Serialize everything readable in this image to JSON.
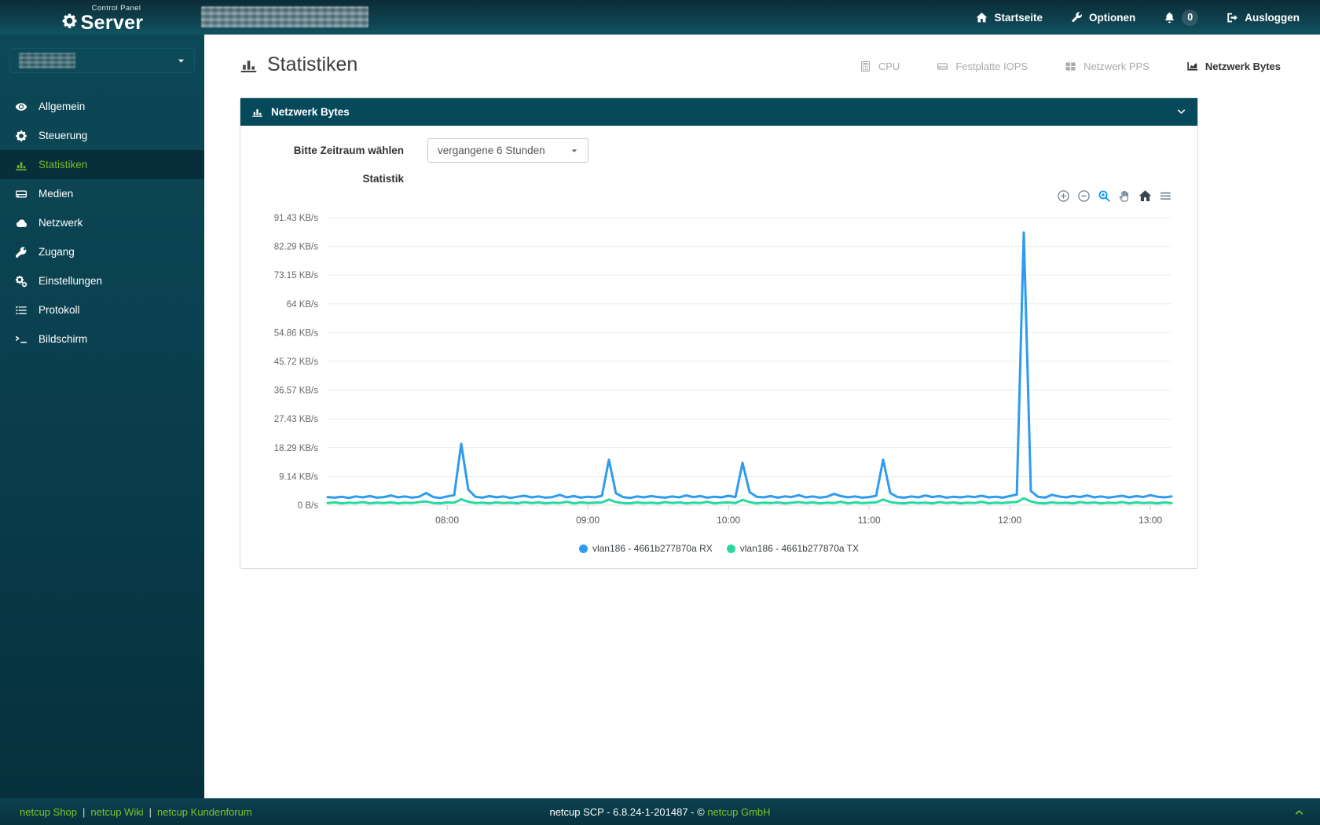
{
  "topbar": {
    "logo_small": "Control Panel",
    "logo_brand": "Server",
    "startseite": "Startseite",
    "optionen": "Optionen",
    "notification_count": "0",
    "ausloggen": "Ausloggen"
  },
  "sidebar": {
    "items": [
      {
        "label": "Allgemein",
        "icon": "eye-icon"
      },
      {
        "label": "Steuerung",
        "icon": "gear-icon"
      },
      {
        "label": "Statistiken",
        "icon": "bar-chart-icon"
      },
      {
        "label": "Medien",
        "icon": "hdd-icon"
      },
      {
        "label": "Netzwerk",
        "icon": "cloud-icon"
      },
      {
        "label": "Zugang",
        "icon": "key-icon"
      },
      {
        "label": "Einstellungen",
        "icon": "gears-icon"
      },
      {
        "label": "Protokoll",
        "icon": "list-icon"
      },
      {
        "label": "Bildschirm",
        "icon": "terminal-icon"
      }
    ]
  },
  "main": {
    "title": "Statistiken",
    "tabs": [
      {
        "label": "CPU",
        "icon": "calculator-icon"
      },
      {
        "label": "Festplatte IOPS",
        "icon": "hdd-icon"
      },
      {
        "label": "Netzwerk PPS",
        "icon": "grid-icon"
      },
      {
        "label": "Netzwerk Bytes",
        "icon": "area-chart-icon"
      }
    ]
  },
  "panel": {
    "title": "Netzwerk Bytes",
    "timerange_label": "Bitte Zeitraum wählen",
    "timerange_value": "vergangene 6 Stunden",
    "statistik_label": "Statistik"
  },
  "chart_data": {
    "type": "line",
    "y_max": 91.43,
    "grid_color": "#ececec",
    "y_ticks": [
      {
        "label": "91.43 KB/s",
        "value": 91.43
      },
      {
        "label": "82.29 KB/s",
        "value": 82.29
      },
      {
        "label": "73.15 KB/s",
        "value": 73.15
      },
      {
        "label": "64 KB/s",
        "value": 64
      },
      {
        "label": "54.86 KB/s",
        "value": 54.86
      },
      {
        "label": "45.72 KB/s",
        "value": 45.72
      },
      {
        "label": "36.57 KB/s",
        "value": 36.57
      },
      {
        "label": "27.43 KB/s",
        "value": 27.43
      },
      {
        "label": "18.29 KB/s",
        "value": 18.29
      },
      {
        "label": "9.14 KB/s",
        "value": 9.14
      },
      {
        "label": "0 B/s",
        "value": 0
      }
    ],
    "x_total_min": 360,
    "x_step_min": 3,
    "x_start_time": "07:09",
    "x_ticks": [
      {
        "label": "08:00",
        "min": 51
      },
      {
        "label": "09:00",
        "min": 111
      },
      {
        "label": "10:00",
        "min": 171
      },
      {
        "label": "11:00",
        "min": 231
      },
      {
        "label": "12:00",
        "min": 291
      },
      {
        "label": "13:00",
        "min": 351
      }
    ],
    "toolbar_icons": [
      "zoom-in",
      "zoom-out",
      "selection-zoom",
      "pan",
      "reset-home",
      "menu"
    ],
    "series": [
      {
        "name": "vlan186 - 4661b277870a RX",
        "color": "#2e9bf0",
        "unit": "KB/s",
        "values": [
          2.6,
          2.4,
          2.7,
          2.3,
          2.8,
          2.5,
          2.9,
          2.4,
          2.6,
          3.1,
          2.5,
          2.8,
          2.4,
          2.7,
          3.9,
          2.6,
          2.3,
          2.8,
          3.2,
          19.5,
          5.0,
          2.7,
          2.4,
          2.9,
          2.5,
          2.8,
          2.3,
          2.7,
          3.0,
          2.5,
          2.8,
          2.4,
          2.6,
          3.3,
          2.5,
          2.9,
          2.4,
          2.7,
          2.5,
          3.0,
          14.5,
          3.8,
          2.6,
          2.3,
          2.8,
          2.5,
          2.9,
          2.6,
          2.4,
          2.8,
          2.5,
          3.1,
          2.6,
          2.9,
          2.4,
          2.7,
          2.5,
          3.0,
          2.6,
          13.5,
          4.2,
          2.7,
          2.5,
          2.9,
          2.4,
          2.8,
          2.6,
          3.2,
          2.5,
          2.8,
          2.4,
          2.7,
          3.6,
          2.9,
          2.5,
          2.8,
          2.4,
          2.6,
          3.0,
          14.5,
          3.9,
          2.6,
          2.4,
          2.8,
          2.5,
          3.1,
          2.6,
          2.9,
          2.4,
          2.7,
          2.5,
          2.8,
          2.6,
          3.0,
          2.5,
          2.7,
          2.4,
          2.9,
          3.4,
          86.7,
          4.5,
          2.7,
          2.4,
          3.3,
          2.8,
          2.5,
          2.9,
          2.6,
          3.1,
          2.5,
          2.8,
          2.4,
          2.7,
          3.0,
          2.5,
          2.9,
          2.6,
          3.2,
          2.7,
          2.5,
          2.8
        ]
      },
      {
        "name": "vlan186 - 4661b277870a TX",
        "color": "#26d9a0",
        "unit": "KB/s",
        "values": [
          0.7,
          0.9,
          0.6,
          0.8,
          0.7,
          1.0,
          0.6,
          0.8,
          0.7,
          0.9,
          0.6,
          0.8,
          0.7,
          1.0,
          1.2,
          0.7,
          0.6,
          0.9,
          0.8,
          1.9,
          1.1,
          0.7,
          0.8,
          0.6,
          0.9,
          0.7,
          0.8,
          0.6,
          1.0,
          0.7,
          0.9,
          0.6,
          0.8,
          0.7,
          1.1,
          0.6,
          0.9,
          0.7,
          0.8,
          0.9,
          1.8,
          1.0,
          0.7,
          0.6,
          0.9,
          0.7,
          0.8,
          0.6,
          1.0,
          0.7,
          0.9,
          0.6,
          0.8,
          0.7,
          1.1,
          0.6,
          0.8,
          0.9,
          0.7,
          1.7,
          1.0,
          0.6,
          0.8,
          0.7,
          0.9,
          0.6,
          0.8,
          1.0,
          0.7,
          0.9,
          0.6,
          0.8,
          0.7,
          1.1,
          0.6,
          0.9,
          0.7,
          0.8,
          0.9,
          1.8,
          1.0,
          0.7,
          0.6,
          0.9,
          0.7,
          0.8,
          0.6,
          1.0,
          0.7,
          0.9,
          0.6,
          0.8,
          0.7,
          1.1,
          0.6,
          0.8,
          0.7,
          0.9,
          1.0,
          2.2,
          1.2,
          0.7,
          0.6,
          0.9,
          0.7,
          0.8,
          0.6,
          1.0,
          0.7,
          0.9,
          0.6,
          0.8,
          0.7,
          1.0,
          0.6,
          0.9,
          0.7,
          0.8,
          0.6,
          0.9,
          0.7
        ]
      }
    ]
  },
  "footer": {
    "links": [
      "netcup Shop",
      "netcup Wiki",
      "netcup Kundenforum"
    ],
    "separator": "|",
    "version_text": "netcup SCP - 6.8.24-1-201487 - ©",
    "company_link": "netcup GmbH"
  },
  "colors": {
    "brand_green": "#76b82a",
    "footer_link_green": "#7ec32a",
    "panel_teal": "#05495a",
    "rx_blue": "#2e9bf0",
    "tx_green": "#26d9a0",
    "toolbar_active_blue": "#008FFB"
  }
}
